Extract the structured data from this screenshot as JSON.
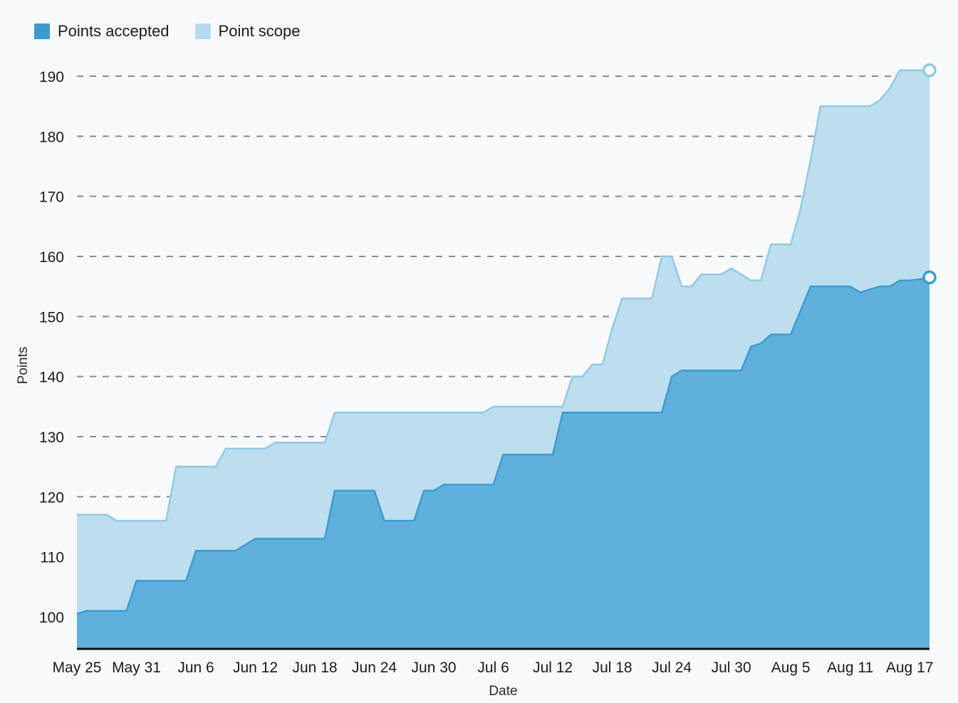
{
  "legend": {
    "position": "top-left",
    "items": [
      {
        "label": "Points accepted",
        "color": "#3e9bd0",
        "swatch_name": "legend-swatch-points-accepted"
      },
      {
        "label": "Point scope",
        "color": "#b6dbef",
        "swatch_name": "legend-swatch-point-scope"
      }
    ]
  },
  "axes": {
    "ylabel": "Points",
    "xlabel": "Date",
    "y_ticks": [
      "100",
      "110",
      "120",
      "130",
      "140",
      "150",
      "160",
      "170",
      "180",
      "190"
    ],
    "x_ticks": [
      "May 25",
      "May 31",
      "Jun 6",
      "Jun 12",
      "Jun 18",
      "Jun 24",
      "Jun 30",
      "Jul 6",
      "Jul 12",
      "Jul 18",
      "Jul 24",
      "Jul 30",
      "Aug 5",
      "Aug 11",
      "Aug 17"
    ]
  },
  "colors": {
    "background": "#f7f9fb",
    "accepted_fill": "#5fb0dd",
    "accepted_stroke": "#3e9bd0",
    "scope_fill": "#bcdeef",
    "scope_stroke": "#92c9e5",
    "gridline": "#8c8c8c",
    "baseline": "#0d0d0d",
    "text": "#1b1b1b"
  },
  "chart_data": {
    "type": "area",
    "title": "",
    "subtitle": "",
    "xlabel": "Date",
    "ylabel": "Points",
    "ylim": [
      98,
      193
    ],
    "grid": true,
    "legend_position": "top-left",
    "x": [
      "May 25",
      "May 26",
      "May 27",
      "May 28",
      "May 29",
      "May 30",
      "May 31",
      "Jun 1",
      "Jun 2",
      "Jun 3",
      "Jun 4",
      "Jun 5",
      "Jun 6",
      "Jun 7",
      "Jun 8",
      "Jun 9",
      "Jun 10",
      "Jun 11",
      "Jun 12",
      "Jun 13",
      "Jun 14",
      "Jun 15",
      "Jun 16",
      "Jun 17",
      "Jun 18",
      "Jun 19",
      "Jun 20",
      "Jun 21",
      "Jun 22",
      "Jun 23",
      "Jun 24",
      "Jun 25",
      "Jun 26",
      "Jun 27",
      "Jun 28",
      "Jun 29",
      "Jun 30",
      "Jul 1",
      "Jul 2",
      "Jul 3",
      "Jul 4",
      "Jul 5",
      "Jul 6",
      "Jul 7",
      "Jul 8",
      "Jul 9",
      "Jul 10",
      "Jul 11",
      "Jul 12",
      "Jul 13",
      "Jul 14",
      "Jul 15",
      "Jul 16",
      "Jul 17",
      "Jul 18",
      "Jul 19",
      "Jul 20",
      "Jul 21",
      "Jul 22",
      "Jul 23",
      "Jul 24",
      "Jul 25",
      "Jul 26",
      "Jul 27",
      "Jul 28",
      "Jul 29",
      "Jul 30",
      "Jul 31",
      "Aug 1",
      "Aug 2",
      "Aug 3",
      "Aug 4",
      "Aug 5",
      "Aug 6",
      "Aug 7",
      "Aug 8",
      "Aug 9",
      "Aug 10",
      "Aug 11",
      "Aug 12",
      "Aug 13",
      "Aug 14",
      "Aug 15",
      "Aug 16",
      "Aug 17",
      "Aug 18",
      "Aug 19"
    ],
    "series": [
      {
        "name": "Point scope",
        "color": "#bcdeef",
        "values": [
          117,
          117,
          117,
          117,
          116,
          116,
          116,
          116,
          116,
          116,
          125,
          125,
          125,
          125,
          125,
          128,
          128,
          128,
          128,
          128,
          129,
          129,
          129,
          129,
          129,
          129,
          134,
          134,
          134,
          134,
          134,
          134,
          134,
          134,
          134,
          134,
          134,
          134,
          134,
          134,
          134,
          134,
          135,
          135,
          135,
          135,
          135,
          135,
          135,
          135,
          140,
          140,
          142,
          142,
          148,
          153,
          153,
          153,
          153,
          160,
          160,
          155,
          155,
          157,
          157,
          157,
          158,
          157,
          156,
          156,
          162,
          162,
          162,
          168,
          176,
          185,
          185,
          185,
          185,
          185,
          185,
          186,
          188,
          191,
          191,
          191,
          191
        ]
      },
      {
        "name": "Points accepted",
        "color": "#5fb0dd",
        "values": [
          100.5,
          101,
          101,
          101,
          101,
          101,
          106,
          106,
          106,
          106,
          106,
          106,
          111,
          111,
          111,
          111,
          111,
          112,
          113,
          113,
          113,
          113,
          113,
          113,
          113,
          113,
          121,
          121,
          121,
          121,
          121,
          116,
          116,
          116,
          116,
          121,
          121,
          122,
          122,
          122,
          122,
          122,
          122,
          127,
          127,
          127,
          127,
          127,
          127,
          134,
          134,
          134,
          134,
          134,
          134,
          134,
          134,
          134,
          134,
          134,
          140,
          141,
          141,
          141,
          141,
          141,
          141,
          141,
          145,
          145.5,
          147,
          147,
          147,
          151,
          155,
          155,
          155,
          155,
          155,
          154,
          154.5,
          155,
          155,
          156,
          156,
          156.2,
          156.5
        ]
      }
    ]
  }
}
